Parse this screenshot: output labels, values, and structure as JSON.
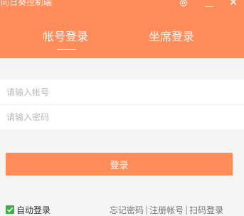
{
  "window": {
    "title": "向日葵控制端",
    "settings_icon": "settings-gear-icon",
    "minimize_icon": "minimize-icon",
    "close_icon": "close-icon",
    "close_glyph": "✕"
  },
  "tabs": {
    "account_login": "帐号登录",
    "agent_login": "坐席登录",
    "active": "account_login"
  },
  "form": {
    "account_placeholder": "请输入帐号",
    "password_placeholder": "请输入密码",
    "account_value": "",
    "password_value": ""
  },
  "actions": {
    "login_label": "登录"
  },
  "footer": {
    "auto_login_label": "自动登录",
    "auto_login_checked": true,
    "forgot_password": "忘记密码",
    "register_account": "注册帐号",
    "scan_login": "扫码登录",
    "separator": "|"
  },
  "colors": {
    "brand": "#ff8c5a",
    "checkbox": "#3fae49",
    "background": "#f5f5f5"
  }
}
